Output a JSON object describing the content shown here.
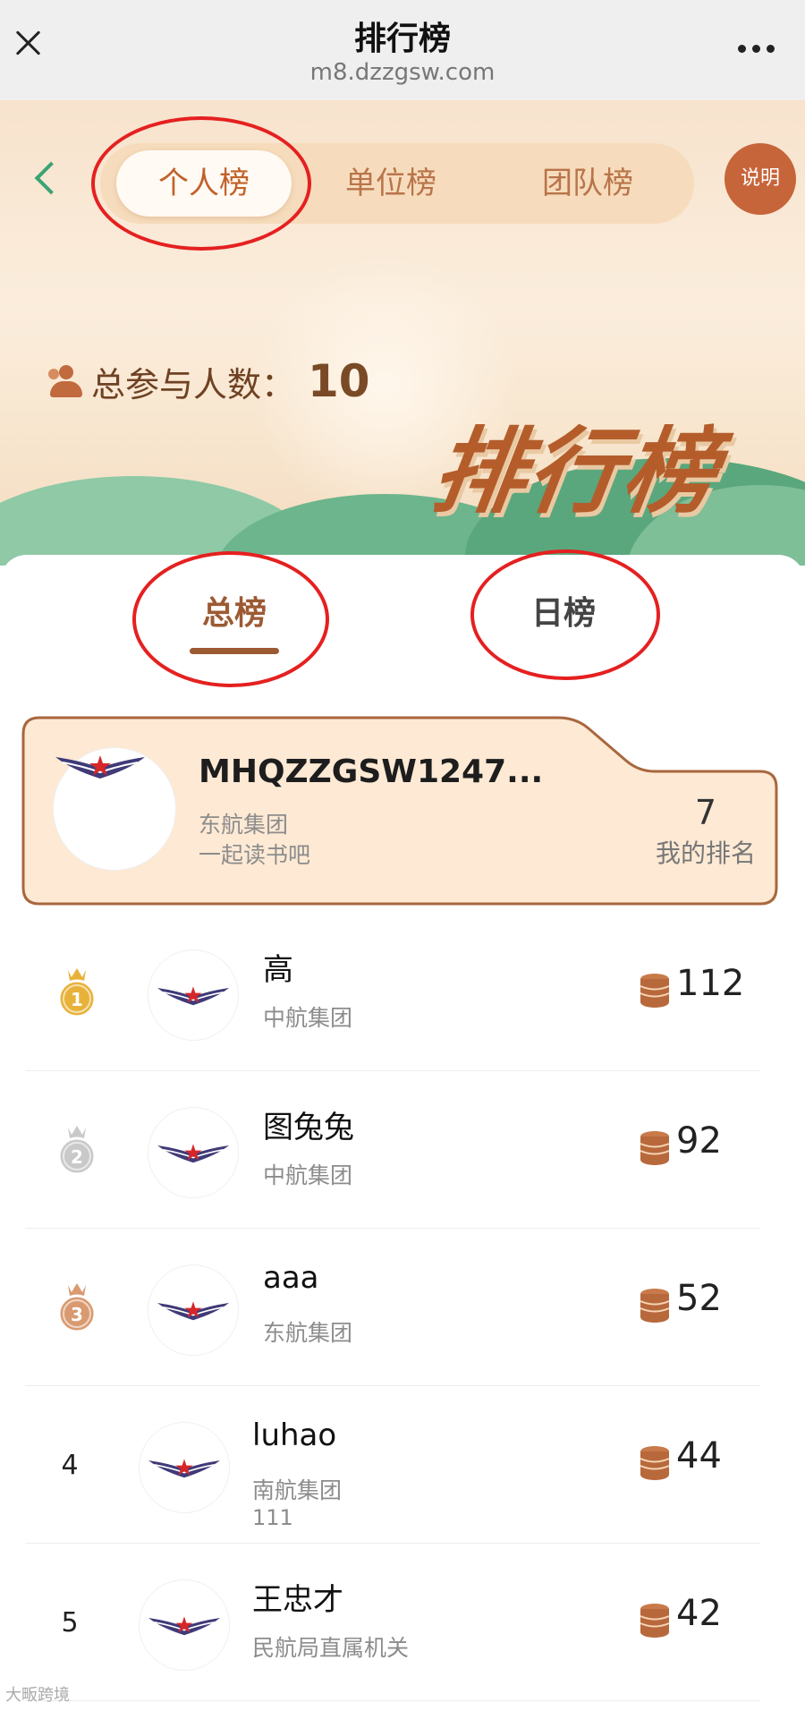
{
  "browser": {
    "title": "排行榜",
    "url": "m8.dzzgsw.com"
  },
  "header": {
    "segments": [
      "个人榜",
      "单位榜",
      "团队榜"
    ],
    "active_segment": 0,
    "help_label": "说明",
    "participants_label": "总参与人数：",
    "participants_count": "10",
    "banner_title": "排行榜"
  },
  "tabs": {
    "items": [
      "总榜",
      "日榜"
    ],
    "active": 0
  },
  "me": {
    "name": "MHQZZGSW1247...",
    "org": "东航集团",
    "motto": "一起读书吧",
    "rank": "7",
    "rank_label": "我的排名"
  },
  "leaderboard": [
    {
      "rank": "1",
      "medal": "gold",
      "name": "高",
      "org": "中航集团",
      "extra": "",
      "score": "112"
    },
    {
      "rank": "2",
      "medal": "silver",
      "name": "图兔兔",
      "org": "中航集团",
      "extra": "",
      "score": "92"
    },
    {
      "rank": "3",
      "medal": "bronze",
      "name": "aaa",
      "org": "东航集团",
      "extra": "",
      "score": "52"
    },
    {
      "rank": "4",
      "medal": "",
      "name": "luhao",
      "org": "南航集团",
      "extra": "111",
      "score": "44"
    },
    {
      "rank": "5",
      "medal": "",
      "name": "王忠才",
      "org": "民航局直属机关",
      "extra": "",
      "score": "42"
    }
  ],
  "watermark": "大畈跨境",
  "colors": {
    "accent": "#c2612a",
    "card_bg": "#fde9d4",
    "annotation_ring": "#e52020",
    "gold": "#e8b23a",
    "silver": "#c9c9c9",
    "bronze": "#d99a70"
  },
  "icons": {
    "close": "close-icon",
    "more": "more-icon",
    "back": "back-chevron-icon",
    "people": "people-icon",
    "coins": "coin-stack-icon",
    "avatar": "airline-wings-logo"
  }
}
